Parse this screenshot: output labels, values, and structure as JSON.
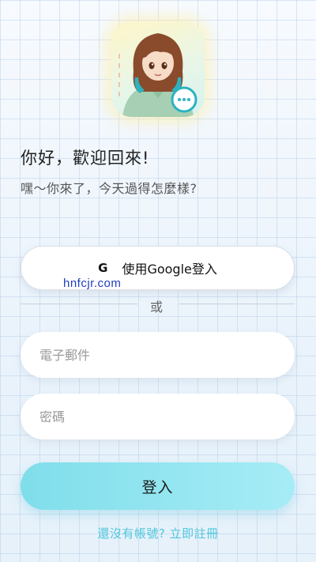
{
  "header": {
    "avatar_icon": "anime-girl-avatar-with-chat-bubble",
    "greeting": "你好，歡迎回來!",
    "subtitle": "嘿～你來了，今天過得怎麼樣?"
  },
  "google_login": {
    "icon_letter": "G",
    "label": "使用Google登入"
  },
  "watermark": "hnfcjr.com",
  "divider": {
    "text": "或"
  },
  "form": {
    "email_placeholder": "電子郵件",
    "password_placeholder": "密碼",
    "login_label": "登入"
  },
  "footer": {
    "register_text": "還沒有帳號? 立即註冊"
  },
  "colors": {
    "accent": "#7fdeea",
    "link": "#4fc6dc",
    "background": "#eef5fb"
  }
}
